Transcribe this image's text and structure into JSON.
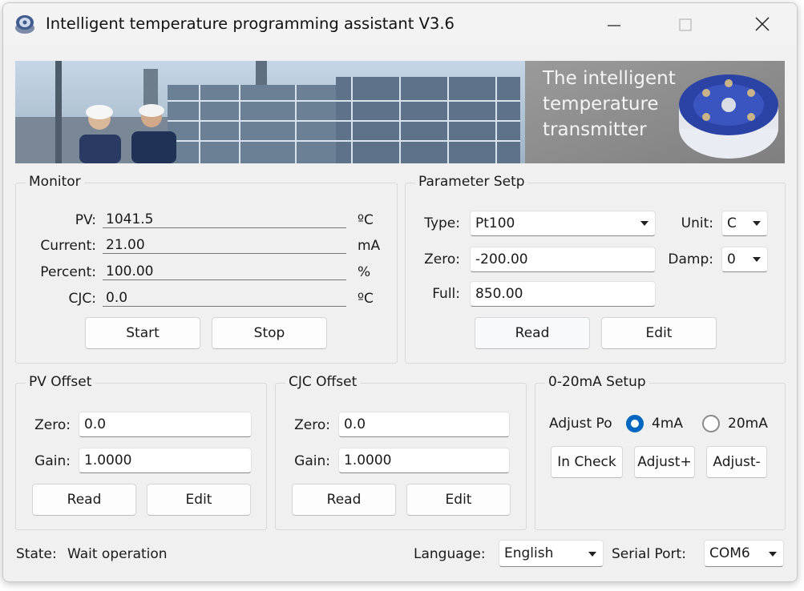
{
  "window": {
    "title": "Intelligent temperature programming assistant V3.6"
  },
  "banner": {
    "line1": "The intelligent",
    "line2": "temperature",
    "line3": "transmitter"
  },
  "monitor": {
    "title": "Monitor",
    "rows": [
      {
        "label": "PV:",
        "value": "1041.5",
        "unit": "ºC"
      },
      {
        "label": "Current:",
        "value": "21.00",
        "unit": "mA"
      },
      {
        "label": "Percent:",
        "value": "100.00",
        "unit": "%"
      },
      {
        "label": "CJC:",
        "value": "0.0",
        "unit": "ºC"
      }
    ],
    "start_label": "Start",
    "stop_label": "Stop"
  },
  "param": {
    "title": "Parameter Setp",
    "type_label": "Type:",
    "type_value": "Pt100",
    "unit_label": "Unit:",
    "unit_value": "C",
    "zero_label": "Zero:",
    "zero_value": "-200.00",
    "damp_label": "Damp:",
    "damp_value": "0",
    "full_label": "Full:",
    "full_value": "850.00",
    "read_label": "Read",
    "edit_label": "Edit"
  },
  "pv_offset": {
    "title": "PV Offset",
    "zero_label": "Zero:",
    "zero_value": "0.0",
    "gain_label": "Gain:",
    "gain_value": "1.0000",
    "read_label": "Read",
    "edit_label": "Edit"
  },
  "cjc_offset": {
    "title": "CJC Offset",
    "zero_label": "Zero:",
    "zero_value": "0.0",
    "gain_label": "Gain:",
    "gain_value": "1.0000",
    "read_label": "Read",
    "edit_label": "Edit"
  },
  "ma_setup": {
    "title": "0-20mA Setup",
    "adjust_label": "Adjust Po",
    "opt1": "4mA",
    "opt2": "20mA",
    "selected": "4mA",
    "in_check_label": "In Check",
    "adjust_plus_label": "Adjust+",
    "adjust_minus_label": "Adjust-"
  },
  "status": {
    "state_label": "State:",
    "state_value": "Wait operation",
    "language_label": "Language:",
    "language_value": "English",
    "port_label": "Serial Port:",
    "port_value": "COM6"
  },
  "colors": {
    "accent": "#0067c0",
    "window_bg": "#f0f0f0"
  },
  "icons": [
    "app-icon",
    "minimize-icon",
    "maximize-icon",
    "close-icon",
    "chevron-down-icon"
  ]
}
